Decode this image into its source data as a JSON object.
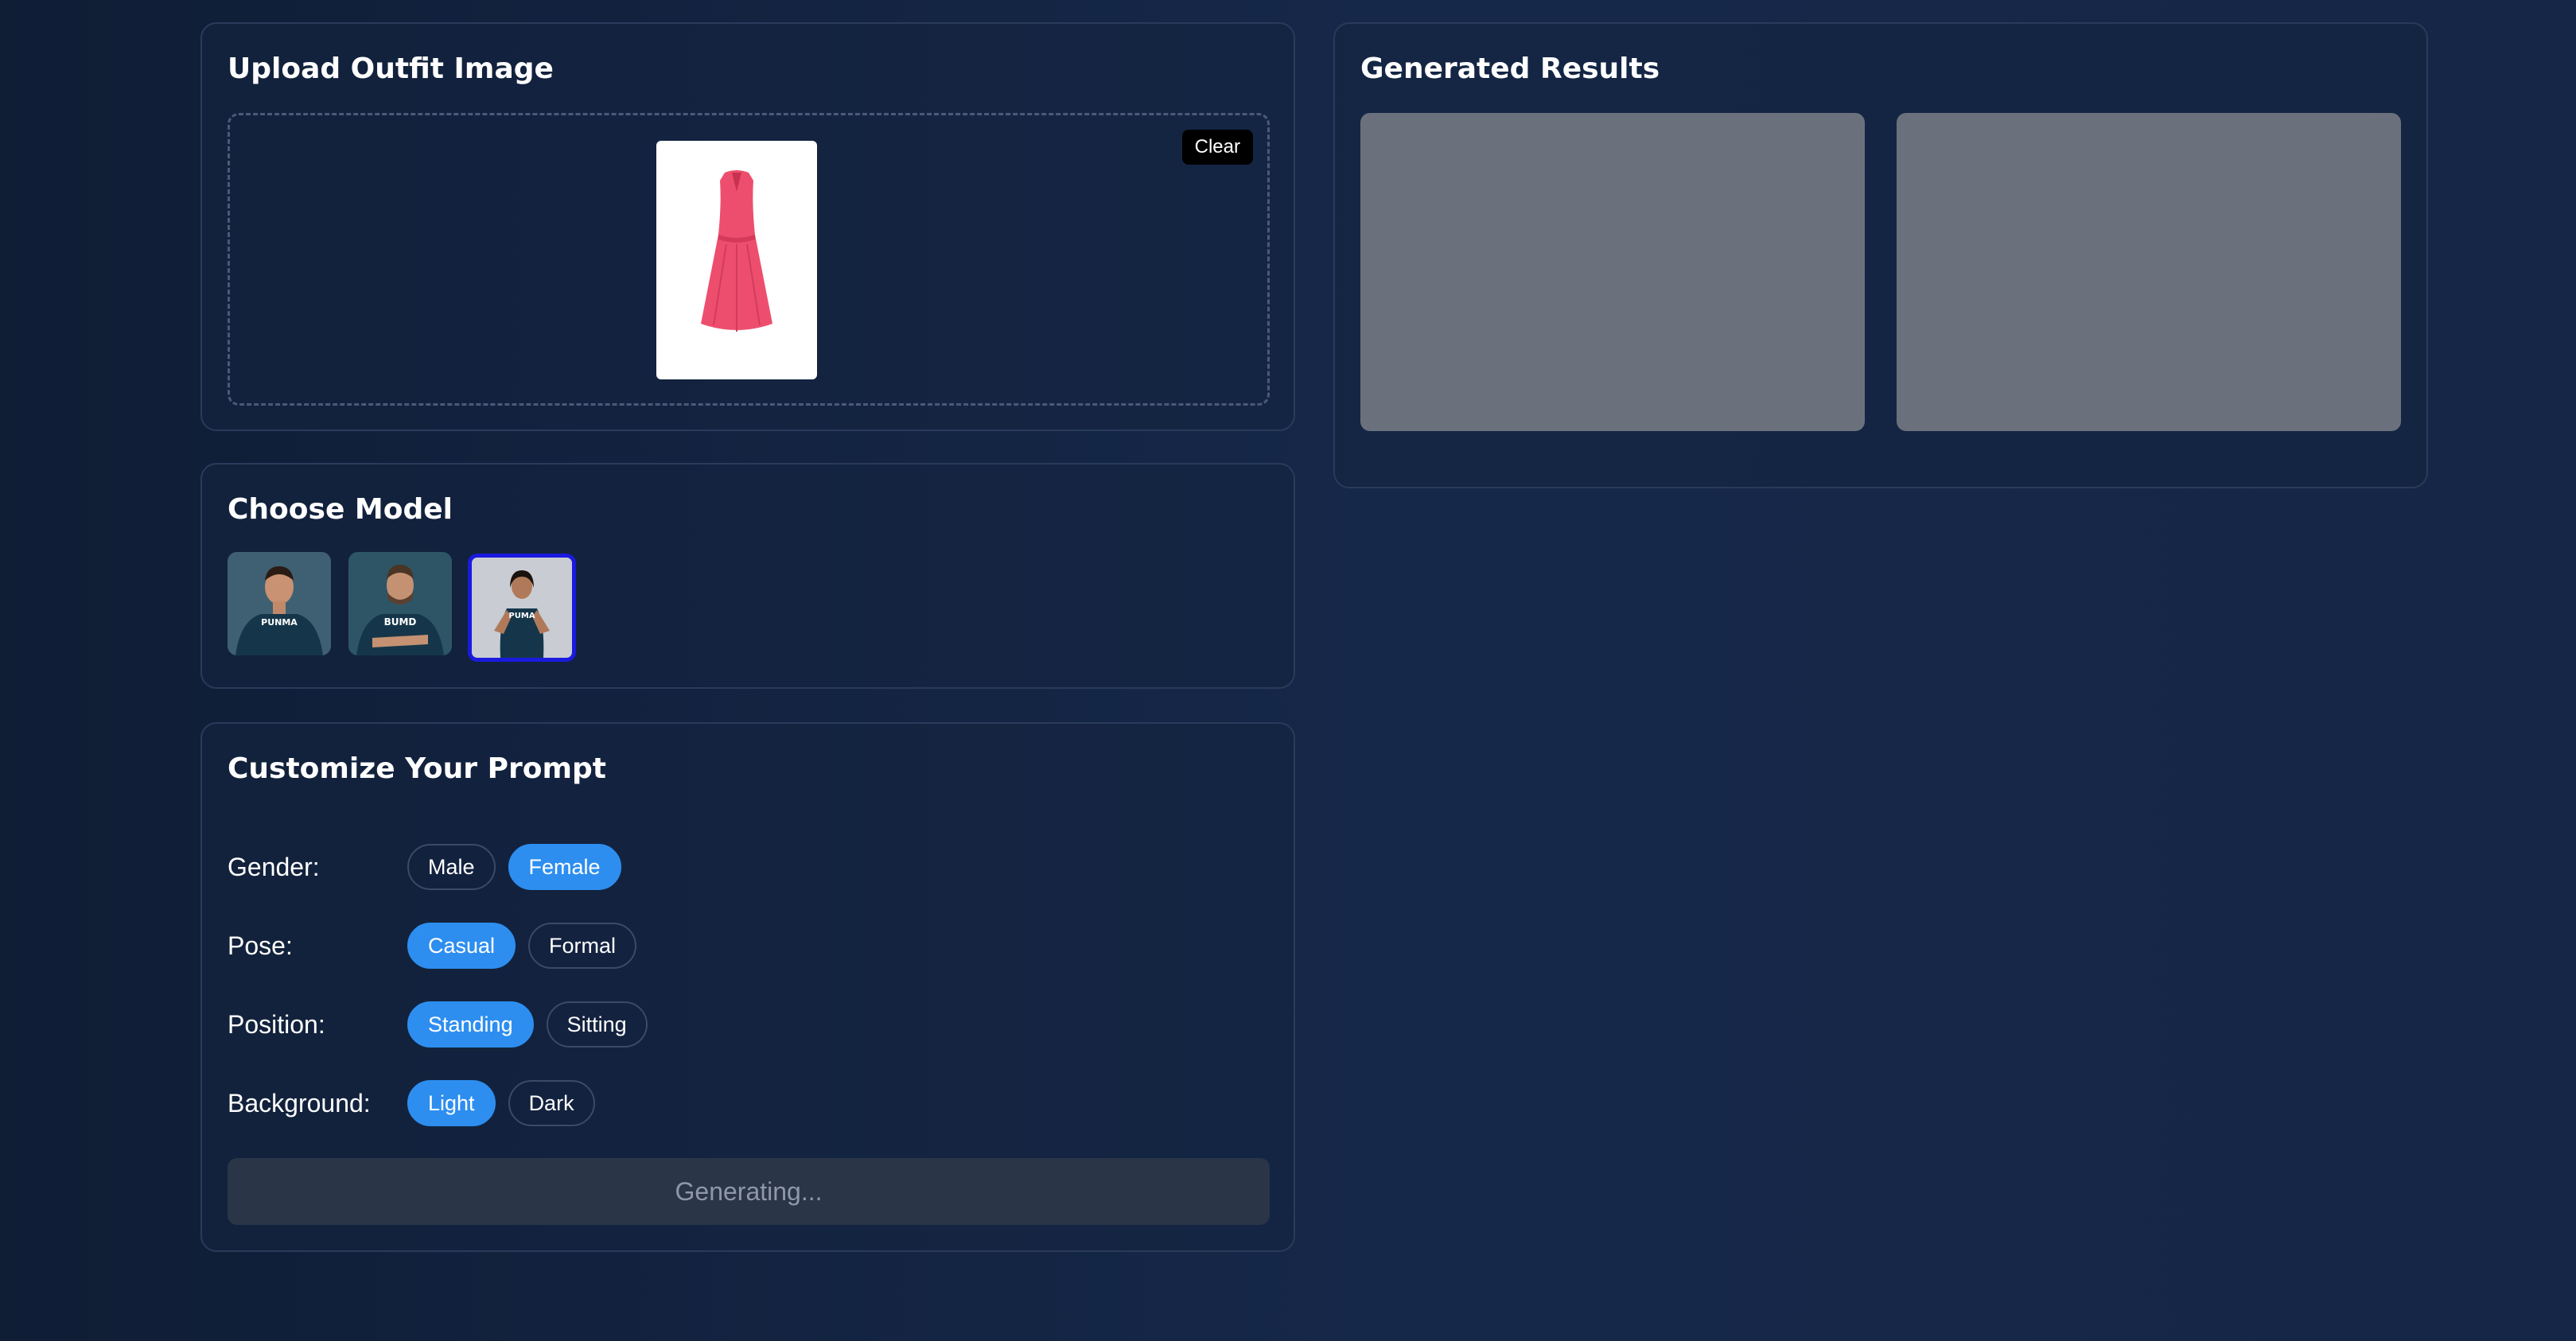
{
  "upload": {
    "title": "Upload Outfit Image",
    "clear_label": "Clear"
  },
  "models": {
    "title": "Choose Model",
    "items": [
      {
        "shirt_text": "PUNMA",
        "selected": false
      },
      {
        "shirt_text": "BUMD",
        "selected": false
      },
      {
        "shirt_text": "PUMA",
        "selected": true
      }
    ]
  },
  "prompt": {
    "title": "Customize Your Prompt",
    "rows": [
      {
        "label": "Gender:",
        "options": [
          "Male",
          "Female"
        ],
        "selected": "Female"
      },
      {
        "label": "Pose:",
        "options": [
          "Casual",
          "Formal"
        ],
        "selected": "Casual"
      },
      {
        "label": "Position:",
        "options": [
          "Standing",
          "Sitting"
        ],
        "selected": "Standing"
      },
      {
        "label": "Background:",
        "options": [
          "Light",
          "Dark"
        ],
        "selected": "Light"
      }
    ],
    "generate_label": "Generating..."
  },
  "results": {
    "title": "Generated Results"
  },
  "colors": {
    "accent": "#2d8ef0",
    "selected_border": "#1a1ae0",
    "placeholder": "#6b717c",
    "outfit_dress": "#ee4e6e"
  }
}
